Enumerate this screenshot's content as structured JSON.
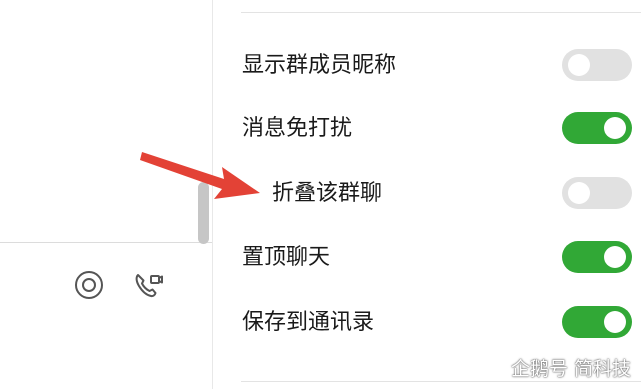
{
  "settings": {
    "items": [
      {
        "label": "显示群成员昵称",
        "enabled": false
      },
      {
        "label": "消息免打扰",
        "enabled": true
      },
      {
        "label": "折叠该群聊",
        "enabled": false
      },
      {
        "label": "置顶聊天",
        "enabled": true
      },
      {
        "label": "保存到通讯录",
        "enabled": true
      }
    ]
  },
  "left_pane": {
    "icons": [
      "target-icon",
      "video-call-icon"
    ]
  },
  "annotation": {
    "arrow_color": "#e34236"
  },
  "colors": {
    "toggle_on": "#31a836",
    "toggle_off": "#e1e1e1"
  },
  "watermark": {
    "text": "企鹅号 简科技"
  }
}
